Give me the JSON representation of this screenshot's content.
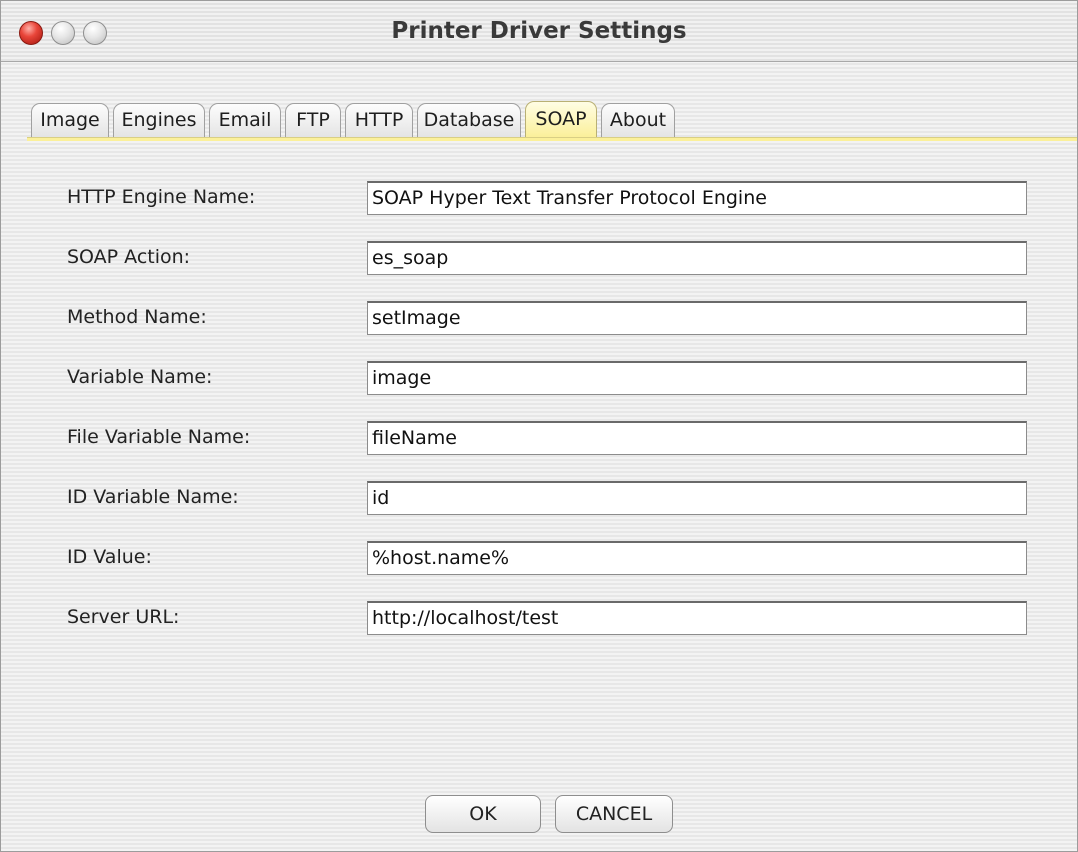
{
  "window": {
    "title": "Printer Driver Settings"
  },
  "tabs": [
    {
      "label": "Image"
    },
    {
      "label": "Engines"
    },
    {
      "label": "Email"
    },
    {
      "label": "FTP"
    },
    {
      "label": "HTTP"
    },
    {
      "label": "Database"
    },
    {
      "label": "SOAP",
      "active": true
    },
    {
      "label": "About"
    }
  ],
  "form": {
    "fields": [
      {
        "label": "HTTP Engine Name:",
        "value": "SOAP Hyper Text Transfer Protocol Engine"
      },
      {
        "label": "SOAP Action:",
        "value": "es_soap"
      },
      {
        "label": "Method Name:",
        "value": "setImage"
      },
      {
        "label": "Variable Name:",
        "value": "image"
      },
      {
        "label": "File Variable Name:",
        "value": "fileName"
      },
      {
        "label": "ID Variable Name:",
        "value": "id"
      },
      {
        "label": "ID Value:",
        "value": "%host.name%"
      },
      {
        "label": "Server URL:",
        "value": "http://localhost/test"
      }
    ]
  },
  "buttons": {
    "ok": "OK",
    "cancel": "CANCEL"
  },
  "colors": {
    "active_tab": "#fbf09a",
    "close_button": "#e9463a"
  }
}
